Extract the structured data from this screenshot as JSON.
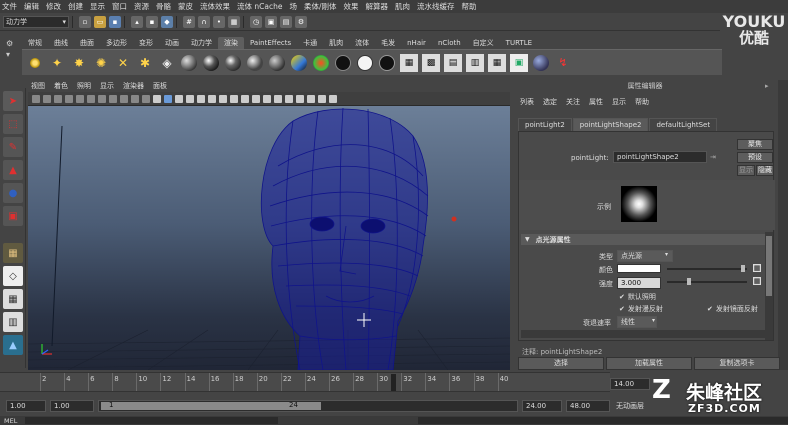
{
  "menubar": {
    "items": [
      "文件",
      "编辑",
      "修改",
      "创建",
      "显示",
      "窗口",
      "资源",
      "骨骼",
      "蒙皮",
      "流体效果",
      "流体 nCache",
      "场",
      "柔体/刚体",
      "效果",
      "解算器",
      "肌肉",
      "流水线缓存",
      "帮助"
    ]
  },
  "statusline": {
    "mode": "动力学"
  },
  "logo": {
    "line1": "YOUKU",
    "line2": "优酷"
  },
  "shelf": {
    "tabs": [
      "常规",
      "曲线",
      "曲面",
      "多边形",
      "变形",
      "动画",
      "动力学",
      "渲染",
      "PaintEffects",
      "卡通",
      "肌肉",
      "流体",
      "毛发",
      "nHair",
      "nCloth",
      "自定义",
      "TURTLE"
    ],
    "active_tab": "渲染"
  },
  "viewport": {
    "menu": [
      "视图",
      "着色",
      "照明",
      "显示",
      "渲染器",
      "面板"
    ]
  },
  "attr_editor": {
    "header": "属性编辑器",
    "menu": [
      "列表",
      "选定",
      "关注",
      "属性",
      "显示",
      "帮助"
    ],
    "tabs": [
      "pointLight2",
      "pointLightShape2",
      "defaultLightSet"
    ],
    "active_tab": "pointLightShape2",
    "node_label": "pointLight:",
    "node_value": "pointLightShape2",
    "btn_focus": "聚焦",
    "btn_presets": "预设",
    "btn_show": "显示",
    "btn_hide": "隐藏",
    "sample_label": "示例",
    "section_title": "点光源属性",
    "type_label": "类型",
    "type_value": "点光源",
    "color_label": "颜色",
    "color_value": "#ffffff",
    "intensity_label": "强度",
    "intensity_value": "3.000",
    "default_light": "默认照明",
    "emit_diffuse": "发射漫反射",
    "emit_specular": "发射镜面反射",
    "decay_label": "衰退速率",
    "decay_value": "线性",
    "notes": "注释: pointLightShape2",
    "btn_select": "选择",
    "btn_load": "加载属性",
    "btn_copy": "复制选项卡"
  },
  "timeline": {
    "ticks": [
      "2",
      "4",
      "6",
      "8",
      "10",
      "12",
      "14",
      "16",
      "18",
      "20",
      "22",
      "24",
      "26",
      "28",
      "30",
      "32",
      "34",
      "36",
      "38",
      "40"
    ],
    "current_frame": "14.00"
  },
  "range": {
    "start": "1.00",
    "start2": "1.00",
    "slider_start": "1",
    "slider_end": "24",
    "end": "24.00",
    "end2": "48.00",
    "anim_layer": "无动画层"
  },
  "command": {
    "label": "MEL"
  },
  "watermark": {
    "brand": "朱峰社区",
    "site": "ZF3D.COM"
  }
}
